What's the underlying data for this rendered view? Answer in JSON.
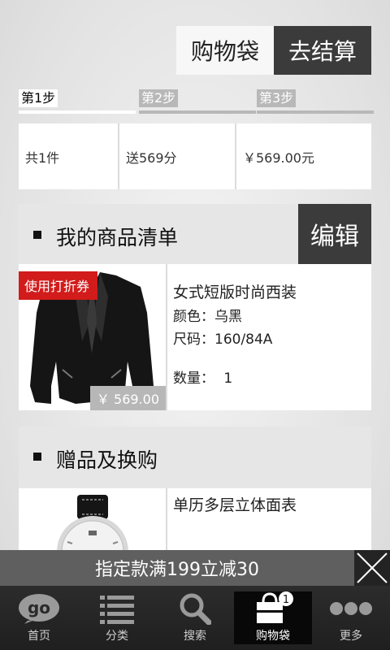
{
  "header": {
    "title": "购物袋",
    "checkout_label": "去结算"
  },
  "steps": [
    {
      "label": "第1步",
      "active": true
    },
    {
      "label": "第2步",
      "active": false
    },
    {
      "label": "第3步",
      "active": false
    }
  ],
  "summary": {
    "count": "共1件",
    "points": "送569分",
    "total": "￥569.00元"
  },
  "product_section": {
    "title": "我的商品清单",
    "edit_label": "编辑"
  },
  "product": {
    "coupon": "使用打折券",
    "price": "￥ 569.00",
    "name": "女式短版时尚西装",
    "color": "颜色：乌黑",
    "size": "尺码：160/84A",
    "qty_label": "数量：",
    "qty": "1"
  },
  "gift_section": {
    "title": "赠品及换购"
  },
  "gift": {
    "name": "单历多层立体面表"
  },
  "promo": {
    "text": "指定款满199立减30"
  },
  "tabs": [
    {
      "label": "首页",
      "icon": "go-home-icon"
    },
    {
      "label": "分类",
      "icon": "list-icon"
    },
    {
      "label": "搜索",
      "icon": "search-icon"
    },
    {
      "label": "购物袋",
      "icon": "shopping-bag-icon",
      "badge": "1"
    },
    {
      "label": "更多",
      "icon": "more-dots-icon"
    }
  ]
}
